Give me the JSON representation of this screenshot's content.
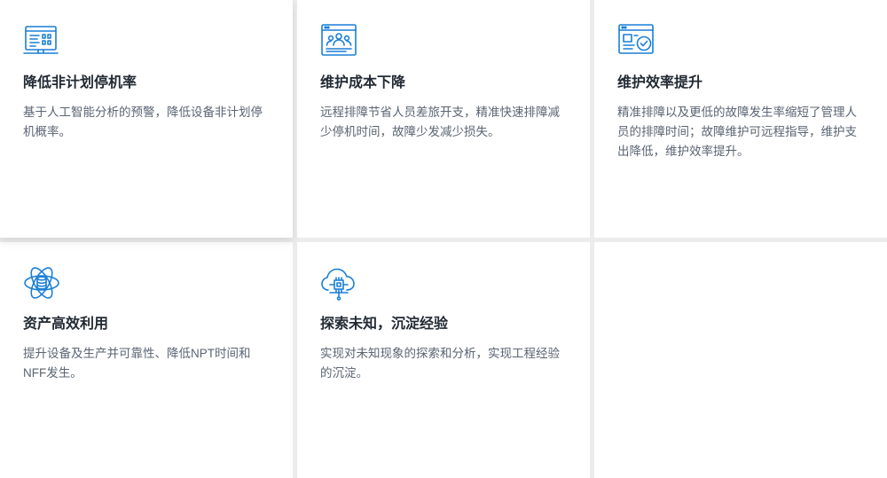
{
  "cards": [
    {
      "icon": "dashboard-monitor-icon",
      "title": "降低非计划停机率",
      "desc": "基于人工智能分析的预警，降低设备非计划停机概率。"
    },
    {
      "icon": "team-window-icon",
      "title": "维护成本下降",
      "desc": "远程排障节省人员差旅开支，精准快速排障减少停机时间，故障少发减少损失。"
    },
    {
      "icon": "checklist-window-icon",
      "title": "维护效率提升",
      "desc": "精准排障以及更低的故障发生率缩短了管理人员的排障时间；故障维护可远程指导，维护支出降低，维护效率提升。"
    },
    {
      "icon": "atom-database-icon",
      "title": "资产高效利用",
      "desc": "提升设备及生产并可靠性、降低NPT时间和NFF发生。"
    },
    {
      "icon": "cloud-chip-icon",
      "title": "探索未知，沉淀经验",
      "desc": "实现对未知现象的探索和分析，实现工程经验的沉淀。"
    }
  ],
  "accent_color": "#1a7fd6"
}
